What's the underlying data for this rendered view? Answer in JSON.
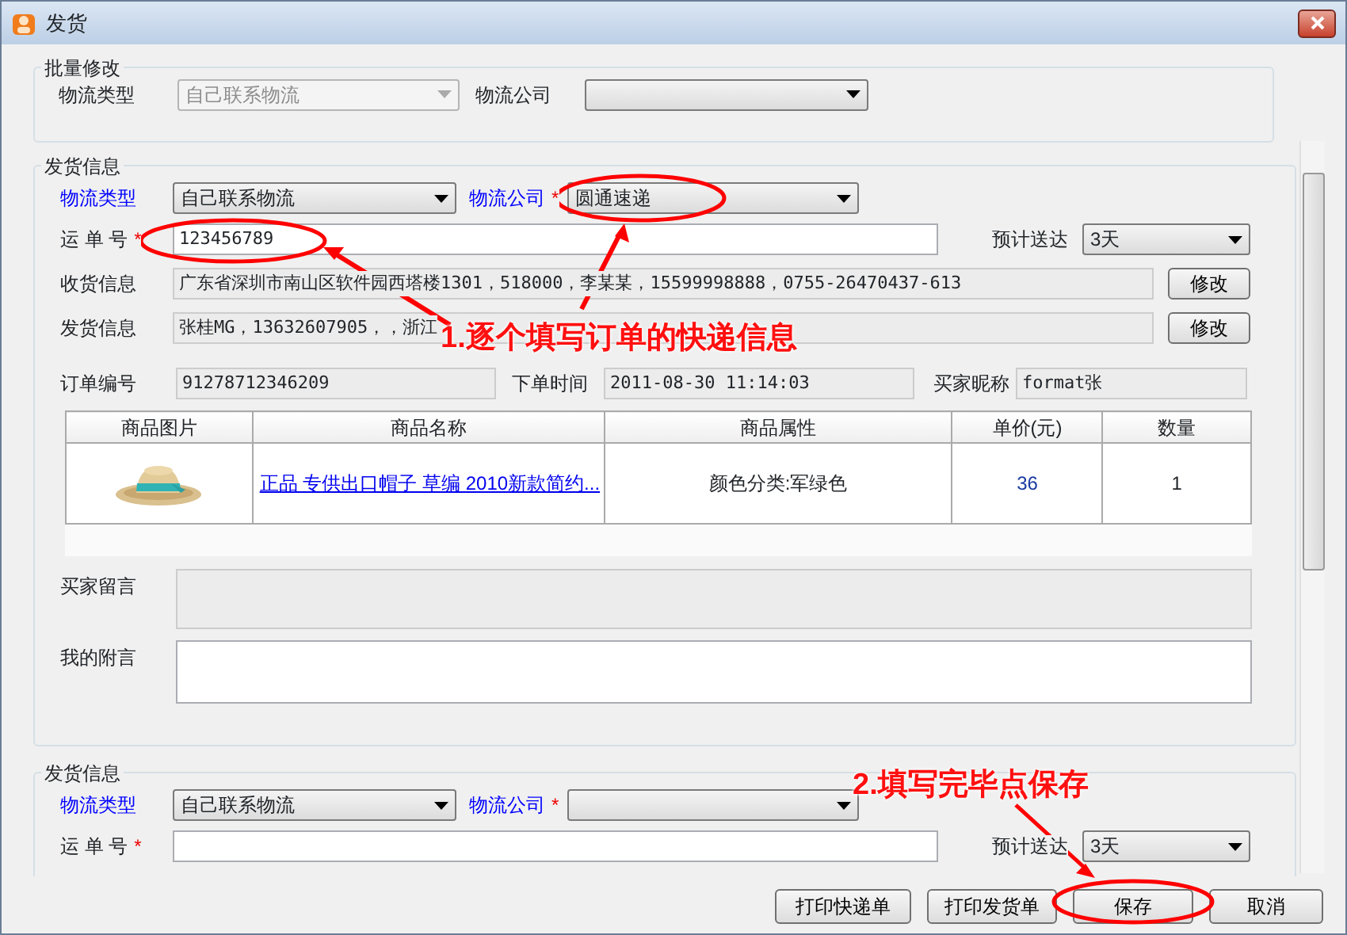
{
  "window": {
    "title": "发货"
  },
  "batch_edit": {
    "title": "批量修改",
    "logistics_type": {
      "label": "物流类型",
      "value": "自己联系物流",
      "disabled": true
    },
    "logistics_company": {
      "label": "物流公司"
    }
  },
  "shipments": [
    {
      "title": "发货信息",
      "logistics_type": {
        "label": "物流类型",
        "value": "自己联系物流"
      },
      "logistics_company": {
        "label": "物流公司",
        "required_mark": "*",
        "value": "圆通速递"
      },
      "tracking_number": {
        "label": "运 单 号",
        "required_mark": "*",
        "value": "123456789"
      },
      "eta": {
        "label": "预计送达",
        "value": "3天"
      },
      "receiver_info": {
        "label": "收货信息",
        "value": "广东省深圳市南山区软件园西塔楼1301，518000，李某某，15599998888，0755-26470437-613",
        "button": "修改"
      },
      "sender_info": {
        "label": "发货信息",
        "value": "张桂MG，13632607905，，浙江",
        "button": "修改"
      },
      "order_no": {
        "label": "订单编号",
        "value": "91278712346209"
      },
      "order_time": {
        "label": "下单时间",
        "value": "2011-08-30 11:14:03"
      },
      "buyer_nick": {
        "label": "买家昵称",
        "value": "format张"
      },
      "items": {
        "columns": [
          "商品图片",
          "商品名称",
          "商品属性",
          "单价(元)",
          "数量"
        ],
        "rows": [
          {
            "name": "正品 专供出口帽子 草编 2010新款简约...",
            "attributes": "颜色分类:军绿色",
            "price": "36",
            "quantity": "1"
          }
        ]
      },
      "buyer_message": {
        "label": "买家留言"
      },
      "my_note": {
        "label": "我的附言"
      }
    },
    {
      "title": "发货信息",
      "logistics_type": {
        "label": "物流类型",
        "value": "自己联系物流"
      },
      "logistics_company": {
        "label": "物流公司",
        "required_mark": "*"
      },
      "tracking_number": {
        "label": "运 单 号",
        "required_mark": "*"
      },
      "eta": {
        "label": "预计送达",
        "value": "3天"
      }
    }
  ],
  "buttons": [
    {
      "label": "打印快递单"
    },
    {
      "label": "打印发货单"
    },
    {
      "label": "保存"
    },
    {
      "label": "取消"
    }
  ],
  "annotations": [
    {
      "text": "1.逐个填写订单的快递信息"
    },
    {
      "text": "2.填写完毕点保存"
    }
  ]
}
